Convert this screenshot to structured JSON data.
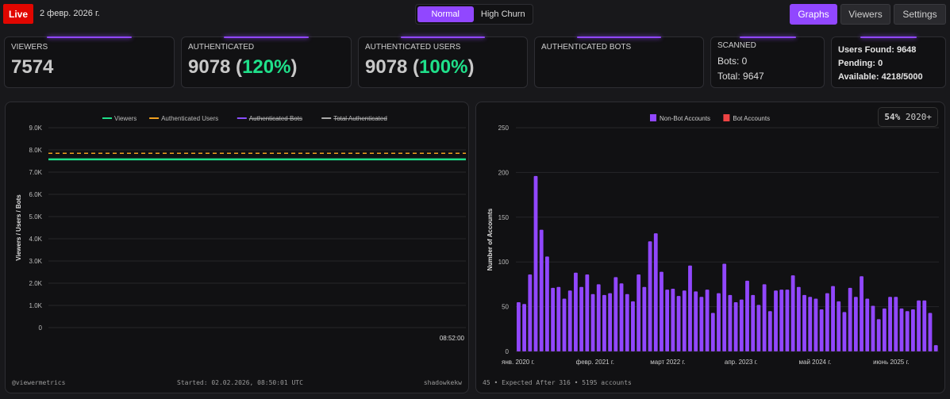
{
  "header": {
    "live_label": "Live",
    "date": "2 февр. 2026 г.",
    "modes": [
      "Normal",
      "High Churn"
    ],
    "active_mode": "Normal",
    "nav": [
      "Graphs",
      "Viewers",
      "Settings"
    ],
    "active_nav": "Graphs",
    "accent": "#9147ff",
    "live_color": "#e10600"
  },
  "cards": {
    "viewers": {
      "label": "VIEWERS",
      "value": "7574"
    },
    "authenticated": {
      "label": "AUTHENTICATED",
      "value": "9078",
      "pct": "120%"
    },
    "authenticated_users": {
      "label": "AUTHENTICATED USERS",
      "value": "9078",
      "pct": "100%"
    },
    "authenticated_bots": {
      "label": "AUTHENTICATED BOTS"
    },
    "scanned": {
      "label": "SCANNED",
      "bots": "Bots: 0",
      "total": "Total: 9647"
    },
    "status": {
      "users_found": "Users Found: 9648",
      "pending": "Pending: 0",
      "available": "Available: 4218/5000"
    }
  },
  "left_panel": {
    "footer_left": "@viewermetrics",
    "footer_center": "Started: 02.02.2026, 08:50:01 UTC",
    "footer_right": "shadowkekw"
  },
  "right_panel": {
    "badge_pct": "54%",
    "badge_label": "2020+",
    "footer": "45 • Expected After 316 • 5195 accounts"
  },
  "chart_data": [
    {
      "type": "line",
      "ylabel": "Viewers / Users / Bots",
      "ylim": [
        0,
        9000
      ],
      "yticks": [
        "0",
        "1.0K",
        "2.0K",
        "3.0K",
        "4.0K",
        "5.0K",
        "6.0K",
        "7.0K",
        "8.0K",
        "9.0K"
      ],
      "xticks": [
        "08:52:00"
      ],
      "grid": true,
      "legend": "top",
      "series": [
        {
          "name": "Viewers",
          "color": "#1fe08a",
          "values": [
            7574,
            7574
          ],
          "hidden": false,
          "dashed": false
        },
        {
          "name": "Authenticated Users",
          "color": "#f0a020",
          "values": [
            7850,
            7850
          ],
          "hidden": false,
          "dashed": true
        },
        {
          "name": "Authenticated Bots",
          "color": "#8a4fff",
          "values": [],
          "hidden": true
        },
        {
          "name": "Total Authenticated",
          "color": "#aaaaaa",
          "values": [],
          "hidden": true
        }
      ]
    },
    {
      "type": "bar",
      "ylabel": "Number of Accounts",
      "ylim": [
        0,
        250
      ],
      "yticks": [
        "0",
        "50",
        "100",
        "150",
        "200",
        "250"
      ],
      "xticks": [
        "янв. 2020 г.",
        "февр. 2021 г.",
        "март 2022 г.",
        "апр. 2023 г.",
        "май 2024 г.",
        "июнь 2025 г."
      ],
      "xtick_index": [
        0,
        13,
        26,
        39,
        52,
        65
      ],
      "grid": true,
      "legend": "top",
      "series": [
        {
          "name": "Non-Bot Accounts",
          "color": "#9147ff",
          "values": [
            55,
            53,
            86,
            196,
            136,
            106,
            71,
            72,
            59,
            68,
            88,
            72,
            86,
            64,
            75,
            63,
            65,
            83,
            76,
            64,
            56,
            86,
            72,
            123,
            132,
            89,
            69,
            70,
            62,
            68,
            96,
            67,
            61,
            69,
            43,
            65,
            98,
            63,
            55,
            58,
            79,
            63,
            52,
            75,
            45,
            68,
            69,
            69,
            85,
            72,
            63,
            61,
            59,
            47,
            65,
            73,
            56,
            44,
            71,
            61,
            84,
            59,
            51,
            36,
            48,
            61,
            61,
            48,
            45,
            47,
            57,
            57,
            43,
            7
          ]
        },
        {
          "name": "Bot Accounts",
          "color": "#ef4444",
          "values": []
        }
      ]
    }
  ]
}
